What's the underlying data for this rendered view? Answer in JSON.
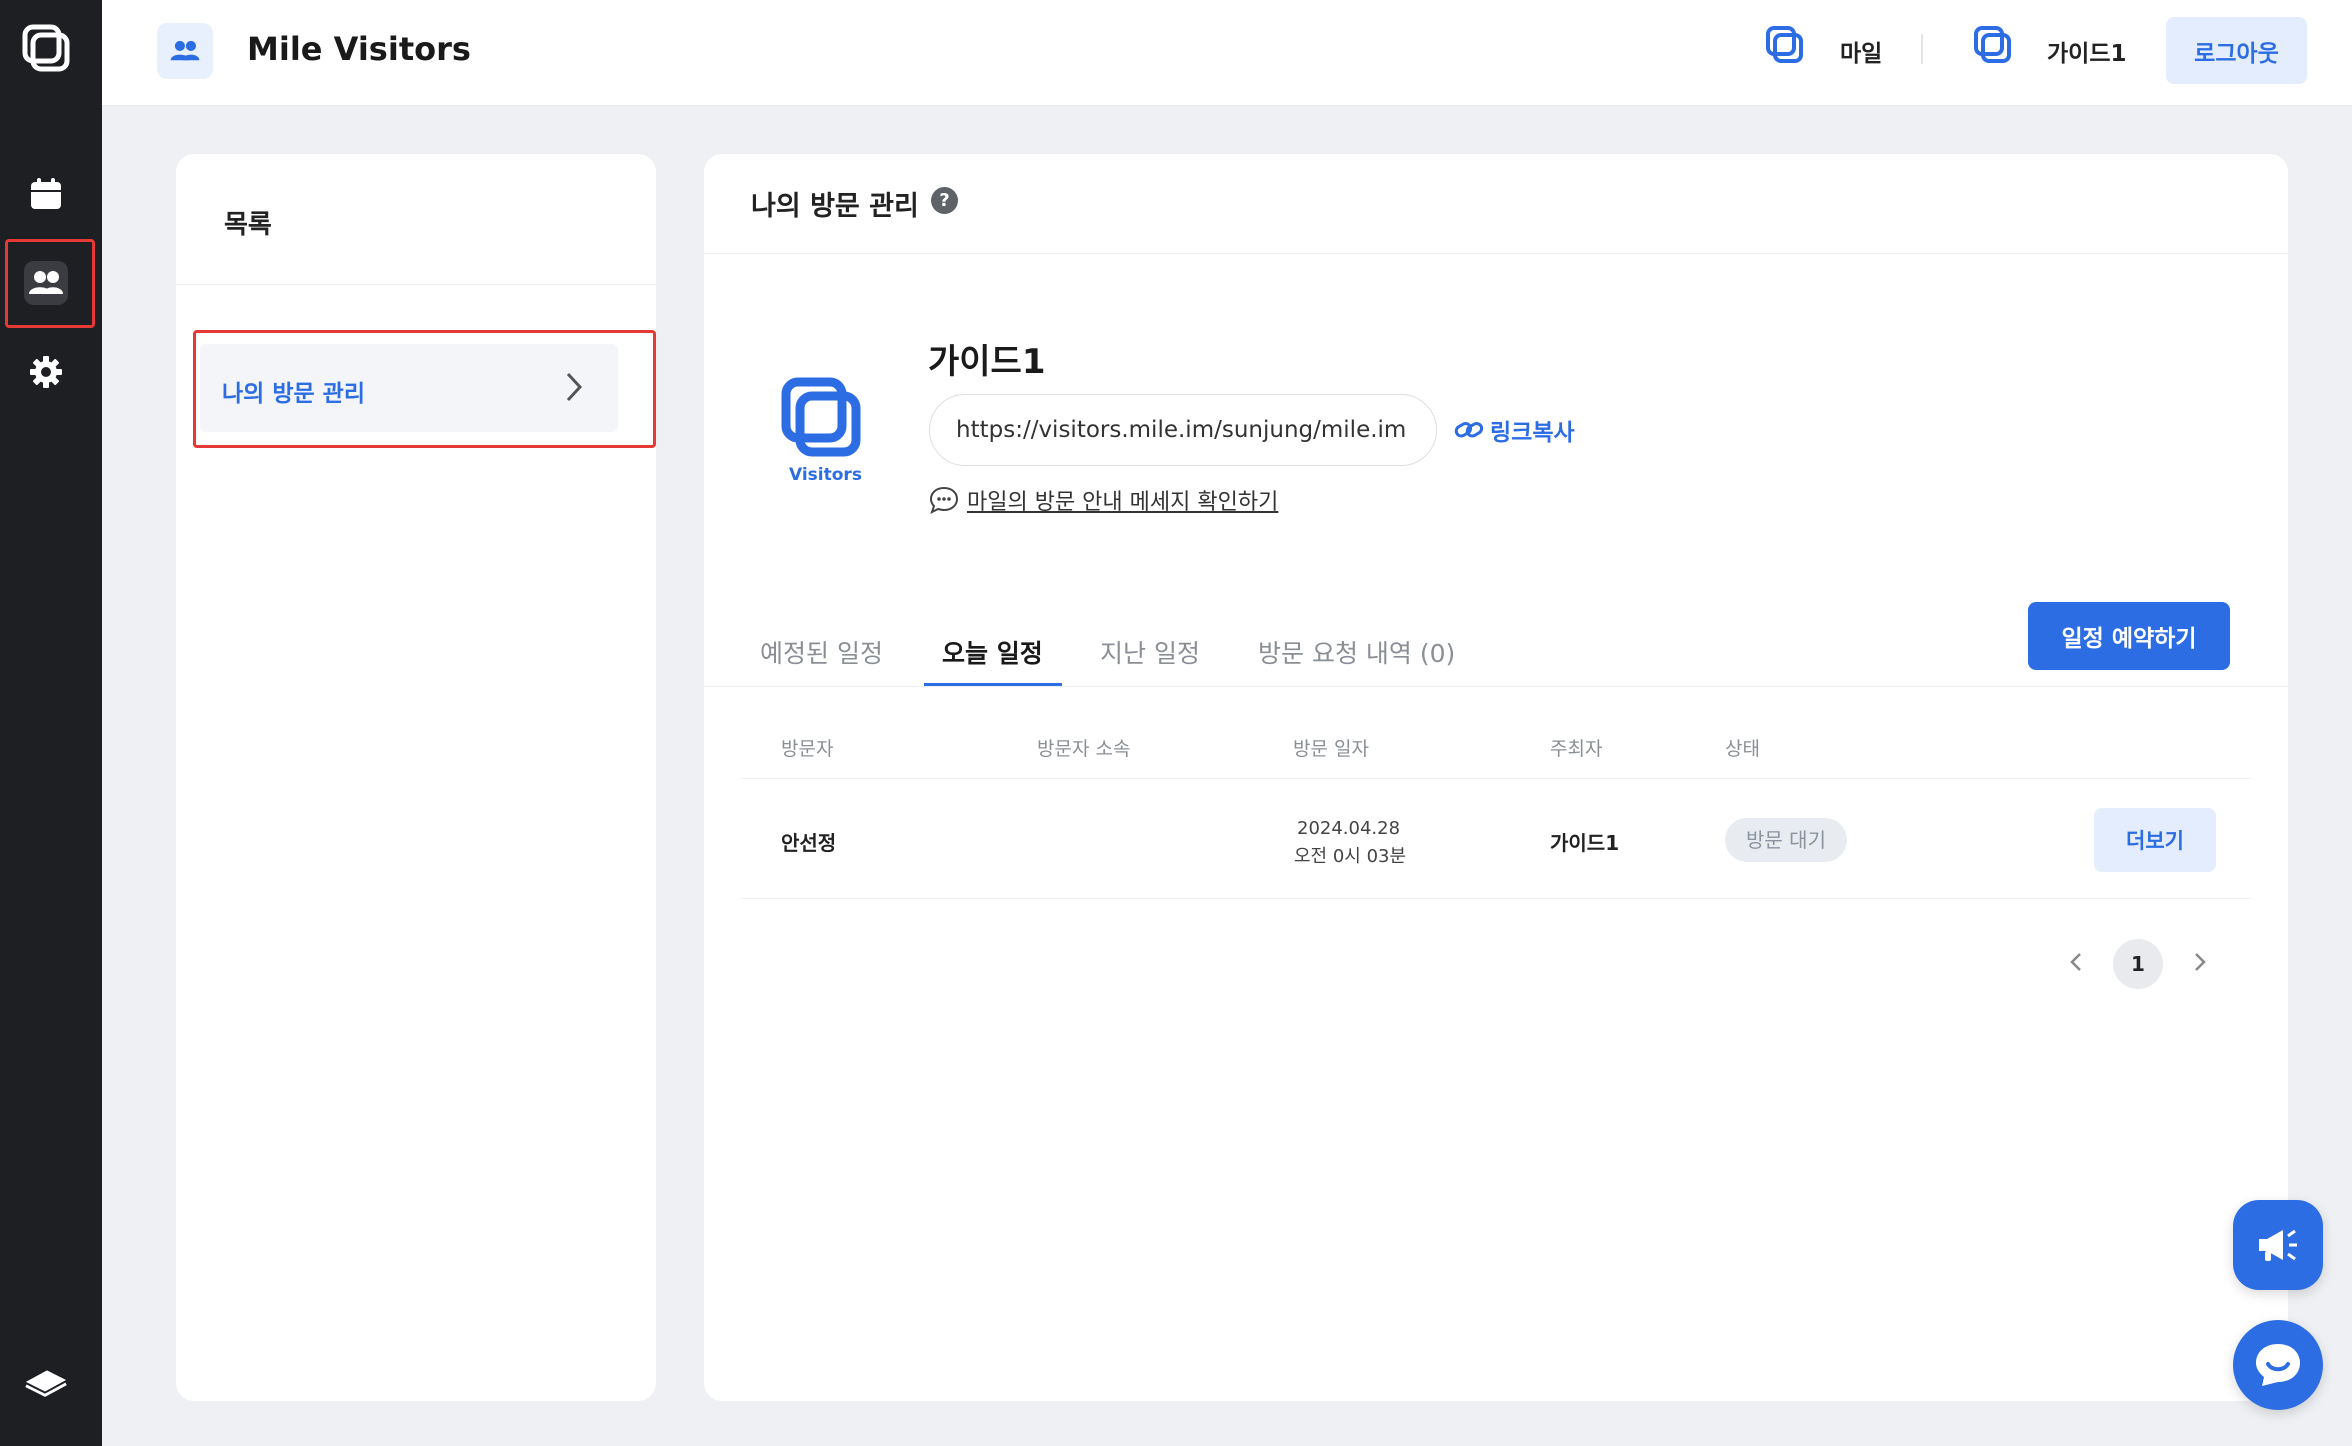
{
  "header": {
    "title": "Mile Visitors",
    "org_label": "마일",
    "user_label": "가이드1",
    "logout_label": "로그아웃"
  },
  "sidebar": {
    "title": "목록",
    "items": [
      {
        "label": "나의 방문 관리",
        "active": true
      }
    ]
  },
  "main": {
    "title": "나의 방문 관리",
    "help_glyph": "?",
    "profile": {
      "name": "가이드1",
      "logo_text": "Visitors",
      "url": "https://visitors.mile.im/sunjung/mile.im",
      "copy_label": "링크복사",
      "message_link": "마일의 방문 안내 메세지 확인하기"
    },
    "tabs": [
      {
        "label": "예정된 일정",
        "active": false
      },
      {
        "label": "오늘 일정",
        "active": true
      },
      {
        "label": "지난 일정",
        "active": false
      },
      {
        "label": "방문 요청 내역 (0)",
        "active": false
      }
    ],
    "reserve_button": "일정 예약하기",
    "table": {
      "headers": [
        "방문자",
        "방문자 소속",
        "방문 일자",
        "주최자",
        "상태"
      ],
      "rows": [
        {
          "visitor": "안선정",
          "affiliation": "",
          "date": "2024.04.28",
          "time": "오전 0시 03분",
          "host": "가이드1",
          "status": "방문 대기",
          "action": "더보기"
        }
      ]
    },
    "pagination": {
      "current": "1"
    }
  },
  "colors": {
    "accent": "#2c6de3",
    "rail": "#1e1f22",
    "highlight": "#e53935"
  }
}
